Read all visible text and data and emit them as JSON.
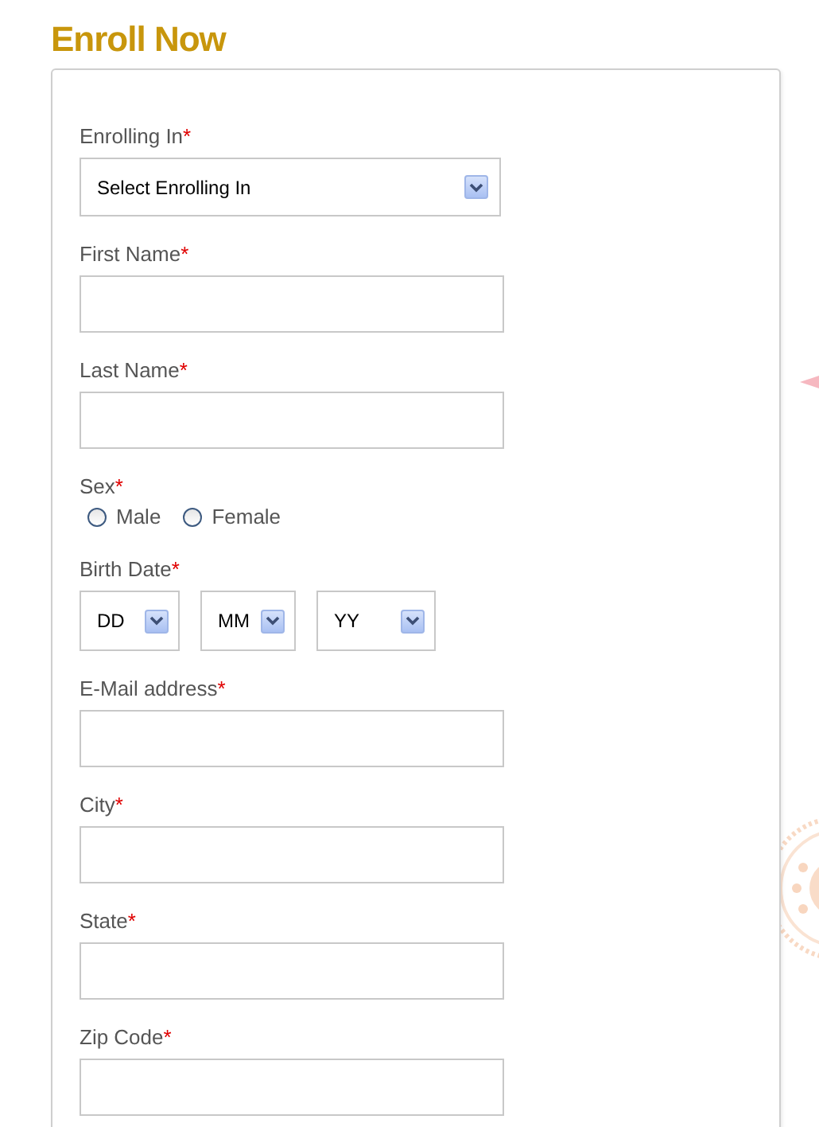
{
  "title": "Enroll Now",
  "fields": [
    {
      "kind": "select",
      "label": "Enrolling In",
      "required_mark": "*",
      "value": "Select Enrolling In"
    },
    {
      "kind": "text",
      "label": "First Name",
      "required_mark": "*"
    },
    {
      "kind": "text",
      "label": "Last Name",
      "required_mark": "*"
    },
    {
      "kind": "radio",
      "label": "Sex",
      "required_mark": "*",
      "options": [
        {
          "label": "Male",
          "selected": false
        },
        {
          "label": "Female",
          "selected": false
        }
      ]
    },
    {
      "kind": "date",
      "label": "Birth Date",
      "required_mark": "*",
      "parts": [
        "DD",
        "MM",
        "YY"
      ]
    },
    {
      "kind": "text",
      "label": "E-Mail address",
      "required_mark": "*"
    },
    {
      "kind": "text",
      "label": "City",
      "required_mark": "*"
    },
    {
      "kind": "text",
      "label": "State",
      "required_mark": "*"
    },
    {
      "kind": "text",
      "label": "Zip Code",
      "required_mark": "*"
    }
  ]
}
